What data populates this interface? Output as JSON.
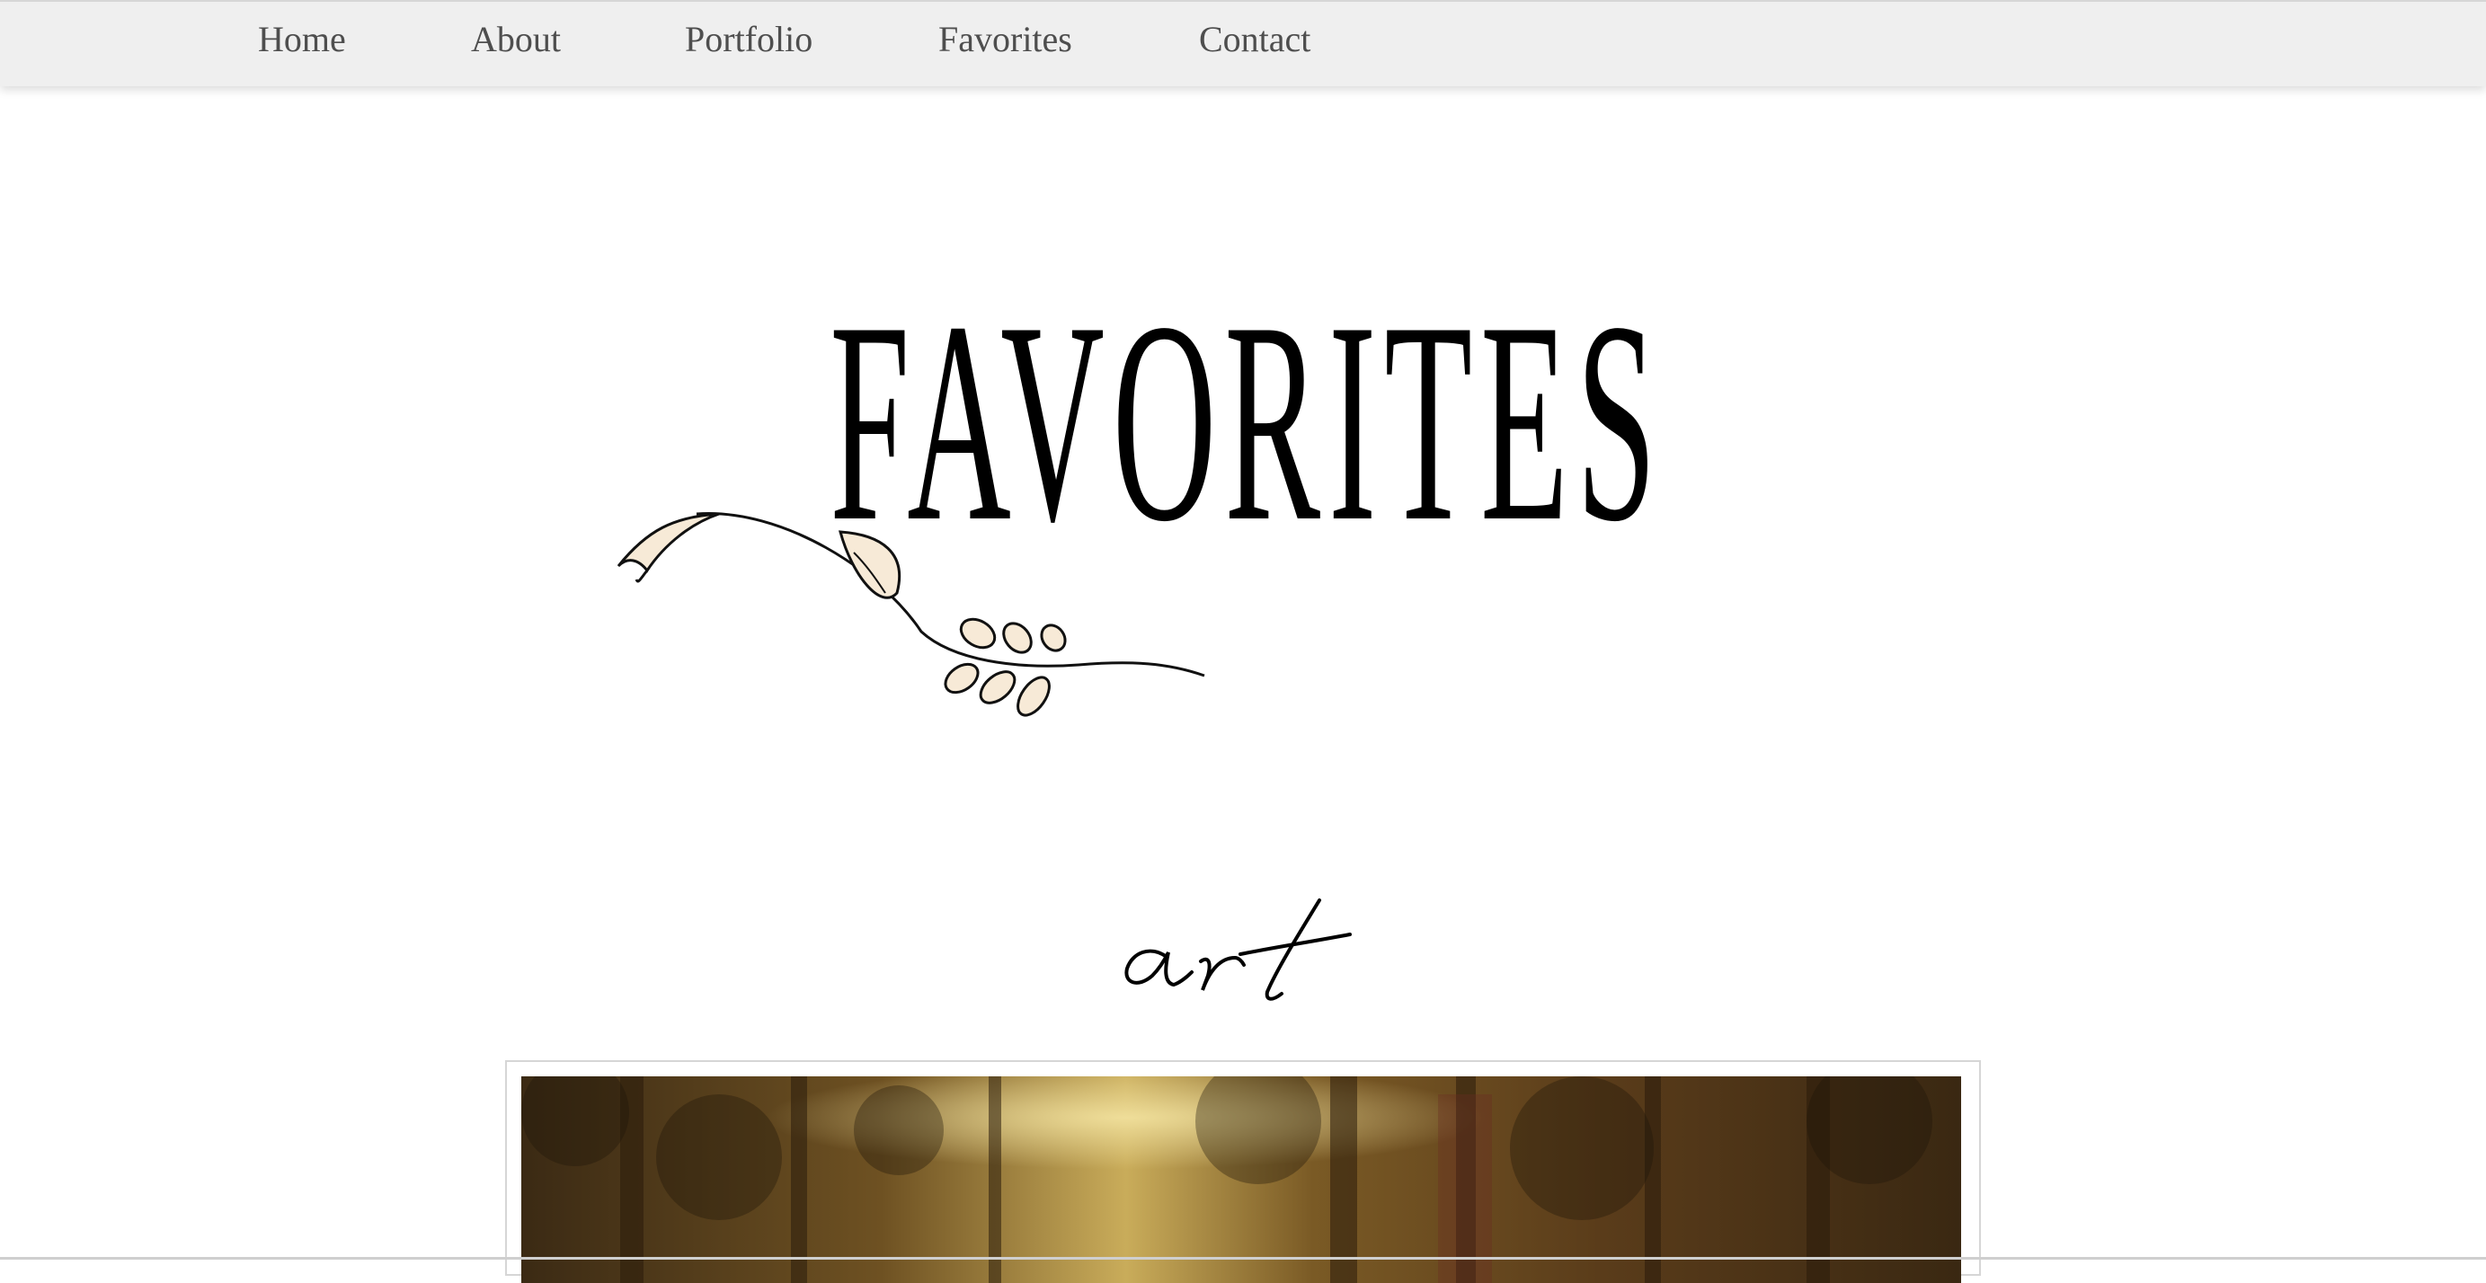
{
  "nav": {
    "items": [
      {
        "label": "Home"
      },
      {
        "label": "About"
      },
      {
        "label": "Portfolio"
      },
      {
        "label": "Favorites"
      },
      {
        "label": "Contact"
      }
    ]
  },
  "hero": {
    "title": "FAVORITES"
  },
  "section": {
    "title": "art"
  },
  "colors": {
    "nav_background": "#efefef",
    "nav_text": "#4e4e4e",
    "title": "#000000",
    "leaf_fill": "#f7ead7"
  }
}
